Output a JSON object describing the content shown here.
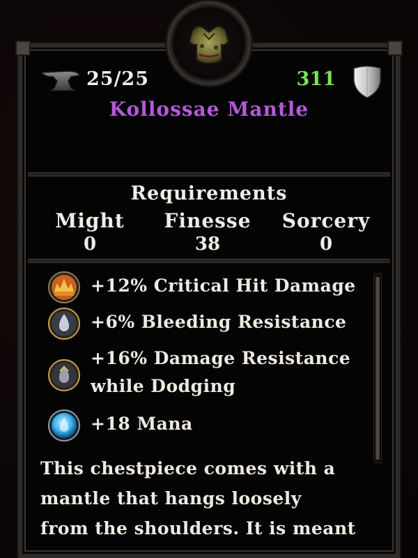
{
  "item": {
    "durability": "25/25",
    "armor": "311",
    "name": "Kollossae Mantle",
    "icon": "chest-armor-icon"
  },
  "requirements": {
    "title": "Requirements",
    "stats": [
      {
        "label": "Might",
        "value": "0"
      },
      {
        "label": "Finesse",
        "value": "38"
      },
      {
        "label": "Sorcery",
        "value": "0"
      }
    ]
  },
  "stats": [
    {
      "line1": "+12% Critical Hit Damage",
      "line2": "",
      "icon": "critical-hit-icon"
    },
    {
      "line1": "+6% Bleeding Resistance",
      "line2": "",
      "icon": "bleed-resist-icon"
    },
    {
      "line1": "+16% Damage Resistance",
      "line2": "while Dodging",
      "icon": "dodge-resist-icon"
    },
    {
      "line1": "+18 Mana",
      "line2": "",
      "icon": "mana-icon"
    }
  ],
  "description": {
    "line1": "This chestpiece comes with a",
    "line2": "mantle that hangs loosely",
    "line3": "from the shoulders. It is meant"
  },
  "colors": {
    "item_name": "#b45ad8",
    "armor_value": "#7ee05a"
  }
}
